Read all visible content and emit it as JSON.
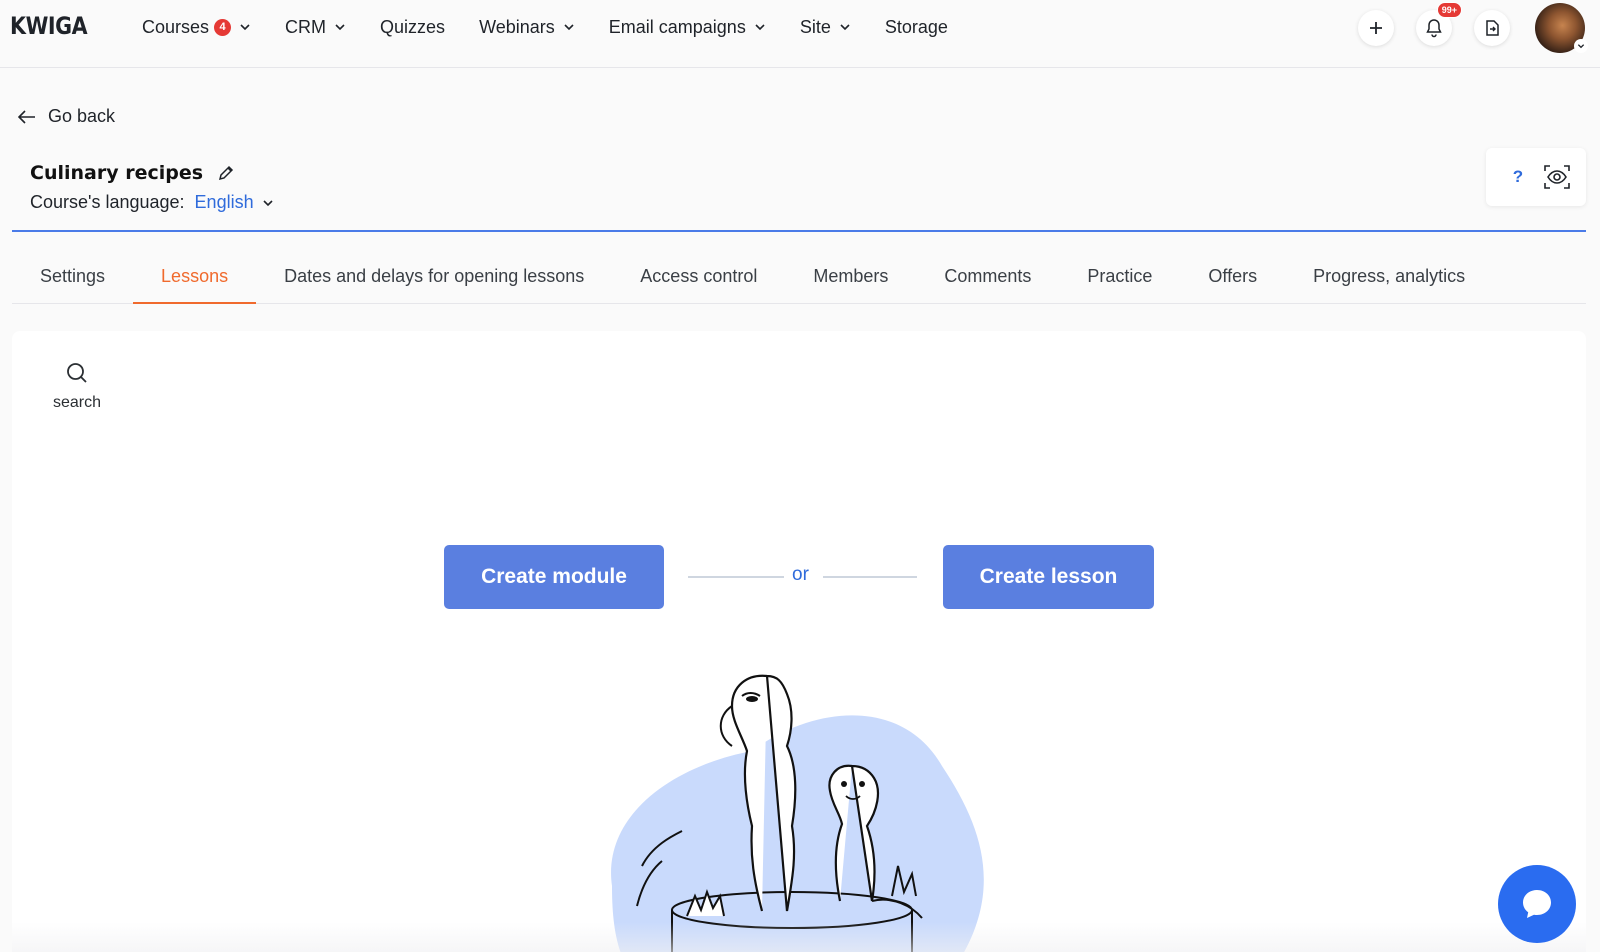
{
  "app": {
    "logo": "KWIGA"
  },
  "nav": {
    "items": [
      {
        "label": "Courses",
        "badge": "4",
        "has_dropdown": true
      },
      {
        "label": "CRM",
        "has_dropdown": true
      },
      {
        "label": "Quizzes",
        "has_dropdown": false
      },
      {
        "label": "Webinars",
        "has_dropdown": true
      },
      {
        "label": "Email campaigns",
        "has_dropdown": true
      },
      {
        "label": "Site",
        "has_dropdown": true
      },
      {
        "label": "Storage",
        "has_dropdown": false
      }
    ],
    "actions": {
      "add_icon": "plus-icon",
      "notifications_icon": "bell-icon",
      "notifications_badge": "99+",
      "switch_icon": "file-switch-icon"
    }
  },
  "header": {
    "back_label": "Go back",
    "course_title": "Culinary recipes",
    "language_label": "Course's language:",
    "language_value": "English",
    "help_label": "?"
  },
  "tabs": [
    {
      "label": "Settings",
      "active": false
    },
    {
      "label": "Lessons",
      "active": true
    },
    {
      "label": "Dates and delays for opening lessons",
      "active": false
    },
    {
      "label": "Access control",
      "active": false
    },
    {
      "label": "Members",
      "active": false
    },
    {
      "label": "Comments",
      "active": false
    },
    {
      "label": "Practice",
      "active": false
    },
    {
      "label": "Offers",
      "active": false
    },
    {
      "label": "Progress, analytics",
      "active": false
    }
  ],
  "main": {
    "search_label": "search",
    "create_module_label": "Create module",
    "or_label": "or",
    "create_lesson_label": "Create lesson",
    "illustration": "meerkats-illustration"
  },
  "colors": {
    "accent_blue": "#2f6bdb",
    "button_blue": "#5a7fe0",
    "active_tab": "#f06a2d",
    "badge_red": "#e53935",
    "chat_blue": "#2a6cf0",
    "blob": "#c9dafc"
  }
}
